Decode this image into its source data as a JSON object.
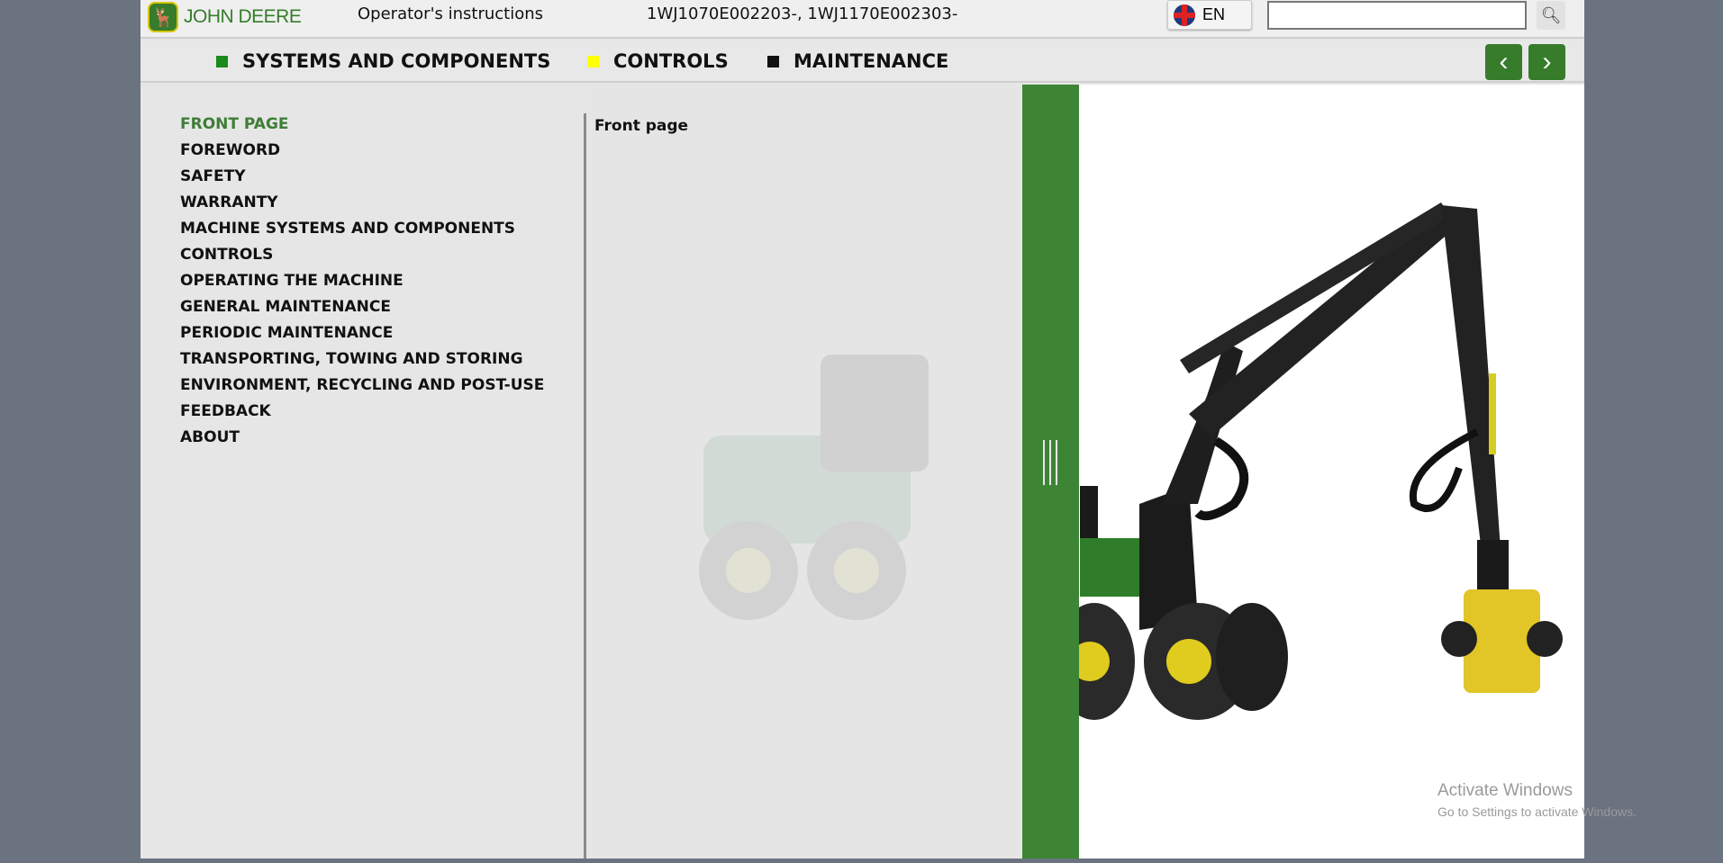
{
  "header": {
    "brand": "JOHN DEERE",
    "title": "Operator's instructions",
    "serials": "1WJ1070E002203-, 1WJ1170E002303-",
    "language": "EN",
    "search_value": "",
    "search_icon": "search-icon"
  },
  "nav": {
    "tabs": [
      {
        "label": "SYSTEMS AND COMPONENTS",
        "color": "#1a8a1a"
      },
      {
        "label": "CONTROLS",
        "color": "#ffff00"
      },
      {
        "label": "MAINTENANCE",
        "color": "#111111"
      }
    ],
    "prev_icon": "chevron-left-icon",
    "next_icon": "chevron-right-icon"
  },
  "sidebar": {
    "items": [
      {
        "label": "FRONT PAGE",
        "active": true
      },
      {
        "label": "FOREWORD"
      },
      {
        "label": "SAFETY"
      },
      {
        "label": "WARRANTY"
      },
      {
        "label": "MACHINE SYSTEMS AND COMPONENTS"
      },
      {
        "label": "CONTROLS"
      },
      {
        "label": "OPERATING THE MACHINE"
      },
      {
        "label": "GENERAL MAINTENANCE"
      },
      {
        "label": "PERIODIC MAINTENANCE"
      },
      {
        "label": "TRANSPORTING, TOWING AND STORING"
      },
      {
        "label": "ENVIRONMENT, RECYCLING AND POST-USE"
      },
      {
        "label": "FEEDBACK"
      },
      {
        "label": "ABOUT"
      }
    ]
  },
  "content": {
    "breadcrumb": "Front page"
  },
  "watermark": {
    "title": "Activate Windows",
    "subtitle": "Go to Settings to activate Windows."
  }
}
